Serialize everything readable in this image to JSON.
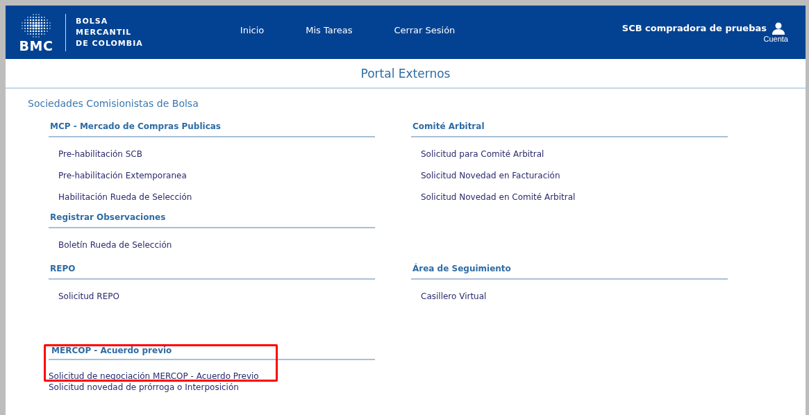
{
  "header": {
    "logo": {
      "mark": "BMC",
      "name_lines": [
        "BOLSA",
        "MERCANTIL",
        "DE COLOMBIA"
      ]
    },
    "nav": [
      {
        "label": "Inicio"
      },
      {
        "label": "Mis Tareas"
      },
      {
        "label": "Cerrar Sesión"
      }
    ],
    "user": {
      "name": "SCB compradora de pruebas",
      "account": "Cuenta"
    }
  },
  "page_title": "Portal Externos",
  "group_title": "Sociedades Comisionistas de Bolsa",
  "rows": [
    {
      "columns": [
        [
          {
            "title": "MCP - Mercado de Compras Publicas",
            "kind": "regular",
            "highlighted": false,
            "items": [
              "Pre-habilitación SCB",
              "Pre-habilitación Extemporanea",
              "Habilitación Rueda de Selección"
            ]
          },
          {
            "title": "Registrar Observaciones",
            "kind": "regular",
            "highlighted": false,
            "items": [
              "Boletín Rueda de Selección"
            ]
          }
        ],
        [
          {
            "title": "Comité Arbitral",
            "kind": "regular",
            "highlighted": false,
            "items": [
              "Solicitud para Comité Arbitral",
              "Solicitud Novedad en Facturación",
              "Solicitud Novedad en Comité Arbitral"
            ]
          }
        ]
      ]
    },
    {
      "columns": [
        [
          {
            "title": "REPO",
            "kind": "regular",
            "highlighted": false,
            "items": [
              "Solicitud REPO"
            ]
          }
        ],
        [
          {
            "title": "Área de Seguimiento",
            "kind": "regular",
            "highlighted": false,
            "items": [
              "Casillero Virtual"
            ]
          }
        ]
      ]
    },
    {
      "columns": [
        [
          {
            "title": "MERCOP - Acuerdo previo",
            "kind": "compact",
            "highlighted": true,
            "items": [
              "Solicitud de negociación MERCOP - Acuerdo Previo"
            ],
            "after_items": [
              "Solicitud novedad de prórroga o Interposición"
            ]
          }
        ],
        []
      ]
    }
  ]
}
